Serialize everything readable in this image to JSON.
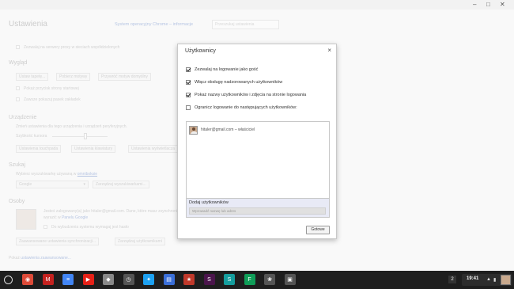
{
  "window": {
    "minimize": "–",
    "maximize": "□",
    "close": "✕"
  },
  "settings": {
    "title": "Ustawienia",
    "header_link": "System operacyjny Chrome – informacje",
    "search_placeholder": "Przeszukaj ustawienia",
    "proxy_text": "Zezwalaj na serwery proxy w sieciach współdzielonych",
    "appearance": {
      "heading": "Wygląd",
      "buttons": [
        "Ustaw tapetę...",
        "Pobierz motywy",
        "Przywróć motyw domyślny"
      ],
      "home_button": "Pokaż przycisk strony startowej",
      "bookmarks_bar": "Zawsze pokazuj pasek zakładek"
    },
    "device": {
      "heading": "Urządzenie",
      "desc": "Zmień ustawienia dla tego urządzenia i urządzeń peryferyjnych.",
      "touchpad_label": "Szybkość kursora",
      "buttons": [
        "Ustawienia touchpada",
        "Ustawienia klawiatury",
        "Ustawienia wyświetlacza"
      ]
    },
    "search": {
      "heading": "Szukaj",
      "desc_prefix": "Wybierz wyszukiwarkę używaną w ",
      "desc_link": "omniboksie",
      "engine": "Google",
      "manage_button": "Zarządzaj wyszukiwarkami..."
    },
    "people": {
      "heading": "Osoby",
      "signed_in": "Jesteś zalogowany(a) jako hitaler@gmail.com. Dane, które masz zsynchronizowane, możesz",
      "dashboard": "Panelu Google",
      "dashboard_prefix": "wyrazić w ",
      "lock_screen": "Do wybudzenia systemu wymagaj jest hasło",
      "buttons": [
        "Zaawansowane ustawienia synchronizacji...",
        "Zarządzaj użytkownikami"
      ]
    },
    "advanced_prefix": "Pokaż ",
    "advanced_link": "ustawienia zaawansowane..."
  },
  "dialog": {
    "title": "Użytkownicy",
    "close": "×",
    "options": [
      {
        "label": "Zezwalaj na logowanie jako gość",
        "checked": true
      },
      {
        "label": "Włącz obsługę nadzorowanych użytkowników",
        "checked": true
      },
      {
        "label": "Pokaż nazwy użytkowników i zdjęcia na stronie logowania",
        "checked": true
      },
      {
        "label": "Ogranicz logowanie do następujących użytkowników:",
        "checked": false
      }
    ],
    "users": [
      {
        "name": "hitaler@gmail.com – właściciel"
      }
    ],
    "add_label": "Dodaj użytkowników",
    "add_placeholder": "Wprowadź nazwę lub adres",
    "done": "Gotowe"
  },
  "shelf": {
    "apps": [
      {
        "name": "chrome-icon",
        "color": "#dd4b39",
        "glyph": "◉"
      },
      {
        "name": "gmail-icon",
        "color": "#c5221f",
        "glyph": "M"
      },
      {
        "name": "docs-icon",
        "color": "#4285f4",
        "glyph": "≡"
      },
      {
        "name": "youtube-icon",
        "color": "#e62117",
        "glyph": "▶"
      },
      {
        "name": "photos-icon",
        "color": "#888888",
        "glyph": "◆"
      },
      {
        "name": "clock-icon",
        "color": "#555555",
        "glyph": "◷"
      },
      {
        "name": "twitter-icon",
        "color": "#1da1f2",
        "glyph": "✦"
      },
      {
        "name": "files-icon",
        "color": "#3b6fd8",
        "glyph": "▤"
      },
      {
        "name": "pocket-icon",
        "color": "#c0392b",
        "glyph": "★"
      },
      {
        "name": "slack-icon",
        "color": "#4a154b",
        "glyph": "S"
      },
      {
        "name": "store-icon",
        "color": "#159d9d",
        "glyph": "S"
      },
      {
        "name": "sheets-icon",
        "color": "#0f9d58",
        "glyph": "F"
      },
      {
        "name": "lotus-icon",
        "color": "#555555",
        "glyph": "❀"
      },
      {
        "name": "settings-app-icon",
        "color": "#555555",
        "glyph": "▣"
      }
    ],
    "notification_count": "2",
    "time": "19:41"
  }
}
